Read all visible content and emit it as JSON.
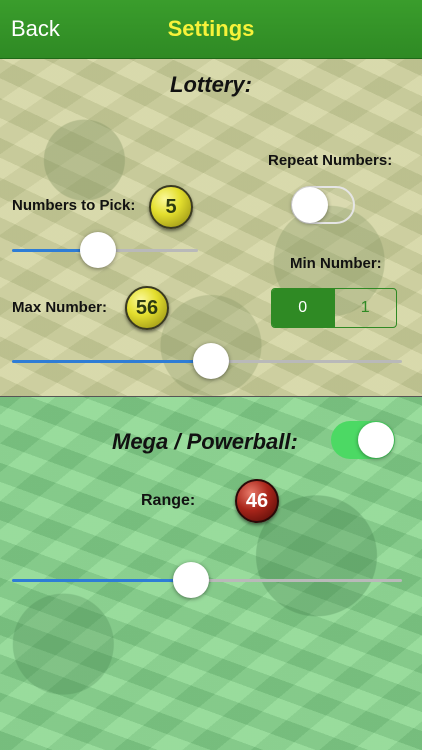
{
  "navbar": {
    "back_label": "Back",
    "title": "Settings"
  },
  "lottery": {
    "heading": "Lottery:",
    "repeat_numbers_label": "Repeat Numbers:",
    "repeat_numbers_on": false,
    "numbers_to_pick_label": "Numbers to Pick:",
    "numbers_to_pick_value": "5",
    "numbers_to_pick_slider_fraction": 0.46,
    "min_number_label": "Min Number:",
    "min_number_options": [
      "0",
      "1"
    ],
    "min_number_selected": "0",
    "max_number_label": "Max Number:",
    "max_number_value": "56",
    "max_number_slider_fraction": 0.51
  },
  "mega": {
    "heading": "Mega / Powerball:",
    "enabled": true,
    "range_label": "Range:",
    "range_value": "46",
    "range_slider_fraction": 0.46
  },
  "colors": {
    "nav_bg": "#2f8a24",
    "nav_title": "#f6f23a",
    "switch_on": "#4cd964",
    "slider_fill": "#2e7dd6"
  }
}
